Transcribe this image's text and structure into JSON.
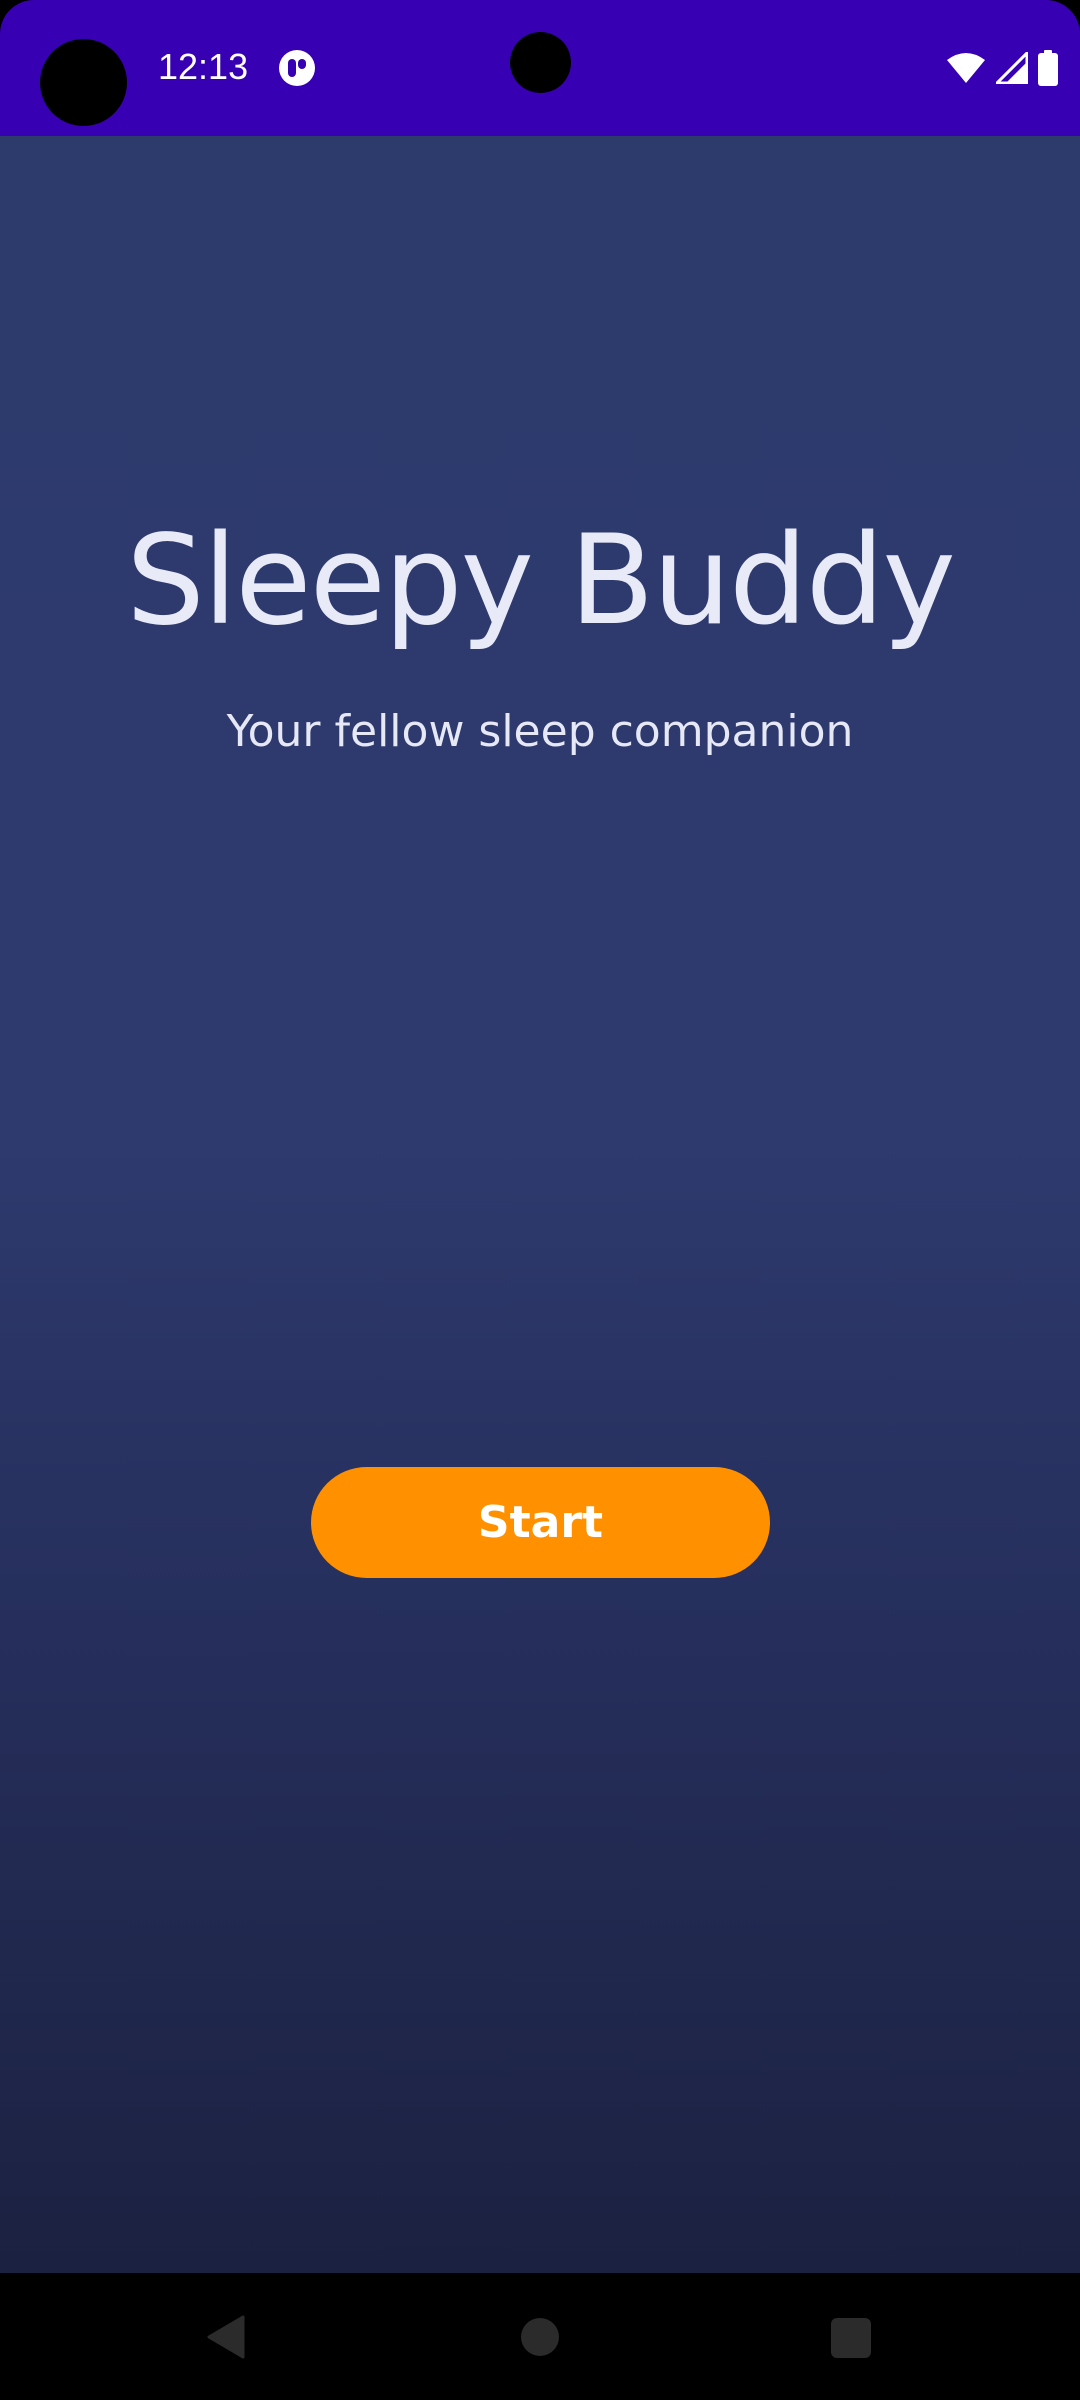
{
  "status_bar": {
    "time": "12:13",
    "background_color": "#3700b3",
    "icons": [
      "notification-app-icon",
      "wifi-icon",
      "signal-icon",
      "battery-icon"
    ]
  },
  "app": {
    "title": "Sleepy Buddy",
    "subtitle": "Your fellow sleep companion",
    "start_label": "Start",
    "colors": {
      "background_top": "#2d3a6c",
      "background_bottom": "#1b2140",
      "accent": "#ff9100",
      "text": "#e8eaf8"
    }
  },
  "nav_bar": {
    "buttons": [
      "back-icon",
      "home-icon",
      "recents-icon"
    ]
  }
}
